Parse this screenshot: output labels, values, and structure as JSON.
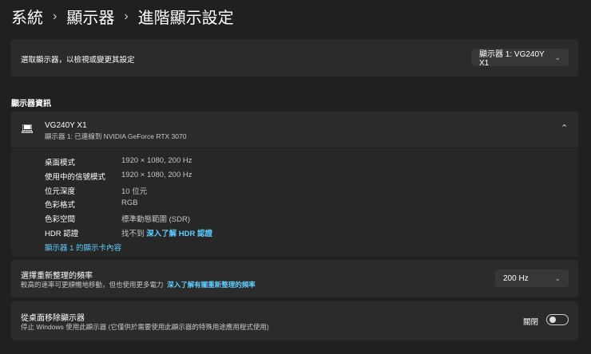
{
  "breadcrumb": [
    "系統",
    "顯示器",
    "進階顯示設定"
  ],
  "breadcrumb_sep": "›",
  "select_display": {
    "label": "選取顯示器，以檢視或變更其設定",
    "value": "顯示器 1: VG240Y X1"
  },
  "section_title": "顯示器資訊",
  "monitor": {
    "name": "VG240Y X1",
    "subtitle": "顯示器 1: 已連線到 NVIDIA GeForce RTX 3070",
    "rows": [
      {
        "key": "桌面模式",
        "value": "1920 × 1080, 200 Hz"
      },
      {
        "key": "使用中的信號模式",
        "value": "1920 × 1080, 200 Hz"
      },
      {
        "key": "位元深度",
        "value": "10 位元"
      },
      {
        "key": "色彩格式",
        "value": "RGB"
      },
      {
        "key": "色彩空間",
        "value": "標準動態範圍 (SDR)"
      }
    ],
    "hdr_key": "HDR 認證",
    "hdr_value": "找不到",
    "hdr_link": "深入了解 HDR 認證",
    "adapter_link": "顯示器 1 的顯示卡內容"
  },
  "refresh": {
    "title": "選擇重新整理的頻率",
    "desc": "較高的速率可更順暢地移動，但也使用更多電力",
    "link": "深入了解有關重新整理的頻率",
    "value": "200 Hz"
  },
  "remove": {
    "title": "從桌面移除顯示器",
    "desc": "停止 Windows 使用此顯示器 (它僅供於需要使用此顯示器的特殊用途應用程式使用)",
    "toggle_label": "關閉",
    "toggle_on": false
  }
}
